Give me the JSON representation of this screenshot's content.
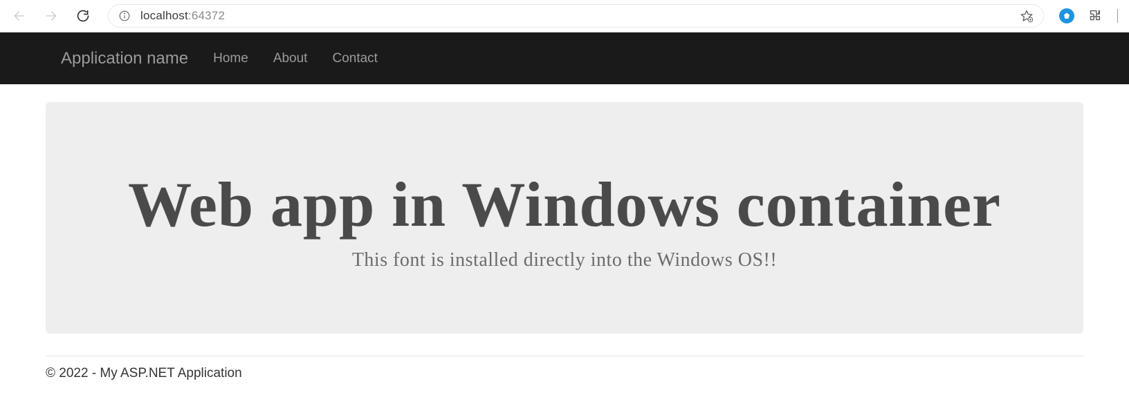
{
  "browser": {
    "url_host": "localhost",
    "url_port": ":64372"
  },
  "navbar": {
    "brand": "Application name",
    "links": {
      "home": "Home",
      "about": "About",
      "contact": "Contact"
    }
  },
  "hero": {
    "title": "Web app in Windows container",
    "subtitle": "This font is installed directly into the Windows OS!!"
  },
  "footer": {
    "text": "© 2022 - My ASP.NET Application"
  }
}
